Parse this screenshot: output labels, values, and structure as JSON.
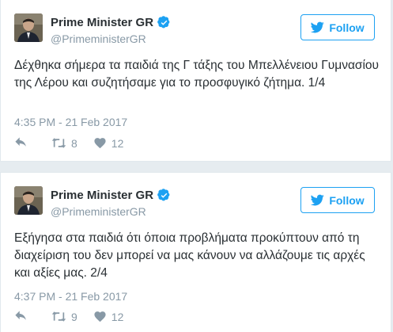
{
  "colors": {
    "accent": "#1da1f2",
    "muted": "#8899a6",
    "text": "#292f33",
    "background": "#e6ecf0"
  },
  "tweets": [
    {
      "author_name": "Prime Minister GR",
      "handle": "@PrimeministerGR",
      "follow_label": "Follow",
      "text": "Δέχθηκα σήμερα τα παιδιά της Γ τάξης του Μπελλένειου Γυμνασίου της Λέρου και συζητήσαμε για το προσφυγικό ζήτημα. 1/4",
      "timestamp": "4:35 PM - 21 Feb 2017",
      "retweets": "8",
      "likes": "12",
      "icons": [
        "avatar-photo",
        "verified-icon",
        "twitter-bird-icon",
        "reply-icon",
        "retweet-icon",
        "heart-icon"
      ]
    },
    {
      "author_name": "Prime Minister GR",
      "handle": "@PrimeministerGR",
      "follow_label": "Follow",
      "text": "Εξήγησα στα παιδιά ότι όποια προβλήματα προκύπτουν από τη διαχείριση του δεν μπορεί να μας κάνουν να αλλάζουμε τις αρχές και αξίες μας. 2/4",
      "timestamp": "4:37 PM - 21 Feb 2017",
      "retweets": "9",
      "likes": "12",
      "icons": [
        "avatar-photo",
        "verified-icon",
        "twitter-bird-icon",
        "reply-icon",
        "retweet-icon",
        "heart-icon"
      ]
    }
  ]
}
